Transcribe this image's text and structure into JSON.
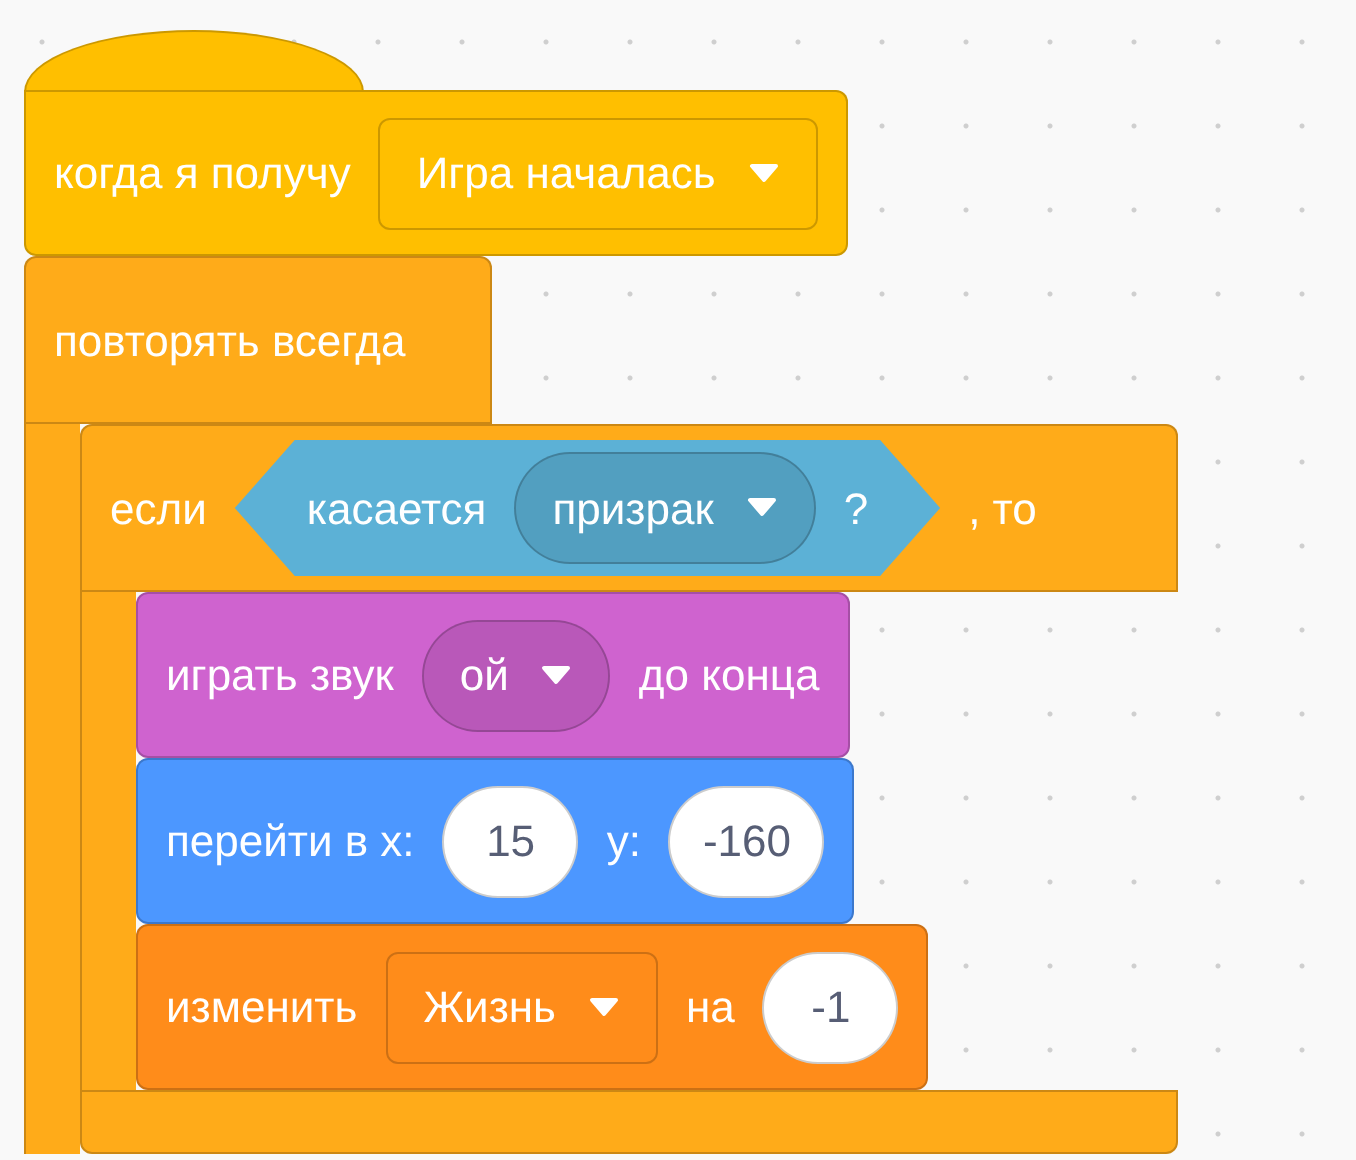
{
  "hat": {
    "color": "#ffbf00",
    "parts": [
      {
        "kind": "text",
        "text": "когда я получу"
      },
      {
        "kind": "dropdown",
        "text": "Игра началась"
      }
    ]
  },
  "forever": {
    "color": "#ffab19",
    "label": "повторять всегда",
    "children": [
      {
        "kind": "if",
        "color": "#ffab19",
        "parts": [
          {
            "kind": "text",
            "text": "если"
          },
          {
            "kind": "condition",
            "color": "#5cb1d6",
            "parts": [
              {
                "kind": "text",
                "text": "касается"
              },
              {
                "kind": "menu",
                "text": "призрак"
              },
              {
                "kind": "text",
                "text": "?"
              }
            ]
          },
          {
            "kind": "text",
            "text": ", то"
          }
        ],
        "children": [
          {
            "kind": "stack",
            "color": "#cf63cf",
            "parts": [
              {
                "kind": "text",
                "text": "играть звук"
              },
              {
                "kind": "menu",
                "text": "ой"
              },
              {
                "kind": "text",
                "text": "до конца"
              }
            ]
          },
          {
            "kind": "stack",
            "color": "#4c97ff",
            "parts": [
              {
                "kind": "text",
                "text": "перейти в х:"
              },
              {
                "kind": "number",
                "text": "15"
              },
              {
                "kind": "text",
                "text": "у:"
              },
              {
                "kind": "number",
                "text": "-160"
              }
            ]
          },
          {
            "kind": "stack",
            "color": "#ff8c1a",
            "parts": [
              {
                "kind": "text",
                "text": "изменить"
              },
              {
                "kind": "dropdown",
                "text": "Жизнь"
              },
              {
                "kind": "text",
                "text": "на"
              },
              {
                "kind": "number",
                "text": "-1"
              }
            ]
          }
        ]
      }
    ]
  }
}
